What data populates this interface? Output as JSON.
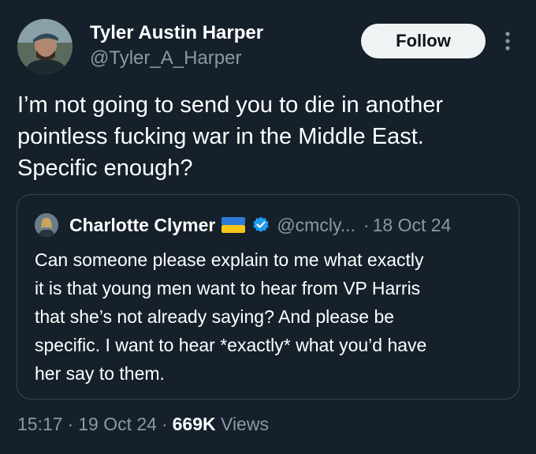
{
  "author": {
    "name": "Tyler Austin Harper",
    "handle": "@Tyler_A_Harper",
    "avatar_icon": "profile-photo"
  },
  "actions": {
    "follow_label": "Follow",
    "more_icon": "more-vertical-icon"
  },
  "tweet": {
    "text": "I’m not going to send you to die in another\npointless fucking war in the Middle East.\nSpecific enough?"
  },
  "quote": {
    "name": "Charlotte Clymer",
    "flag_icon": "ukraine-flag-icon",
    "verified_icon": "verified-badge-icon",
    "handle": "@cmcly...",
    "separator": "·",
    "date": "18 Oct 24",
    "text": "Can someone please explain to me what exactly\nit is that young men want to hear from VP Harris\nthat she’s not already saying? And please be\nspecific. I want to hear *exactly* what you’d have\nher say to them."
  },
  "meta": {
    "time": "15:17",
    "separator": "·",
    "date": "19 Oct 24",
    "views_count": "669K",
    "views_label": "Views"
  },
  "colors": {
    "background": "#15202b",
    "secondary_text": "#8b98a5",
    "border": "#38444d",
    "follow_bg": "#eff3f4",
    "verified": "#1d9bf0"
  }
}
